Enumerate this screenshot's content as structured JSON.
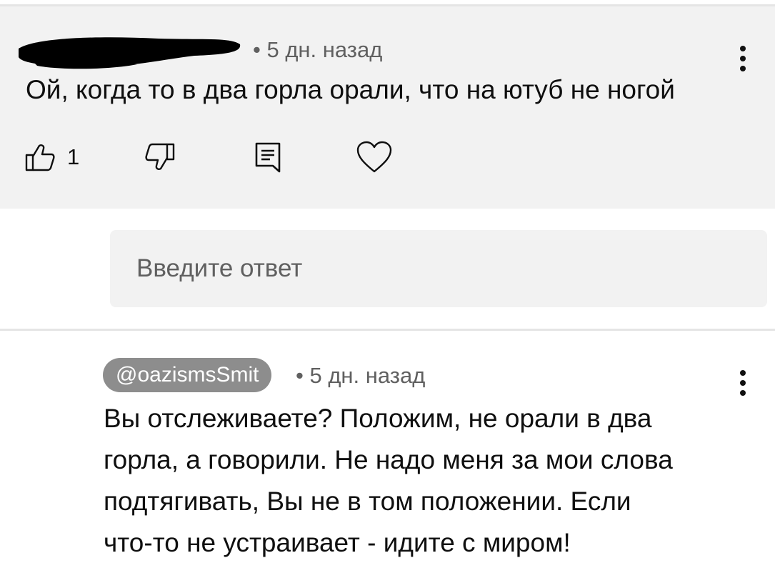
{
  "comment": {
    "time": "• 5 дн. назад",
    "text": "Ой, когда то в два горла орали, что на ютуб не ногой",
    "like_count": "1",
    "icons": {
      "like": "thumbs-up-icon",
      "dislike": "thumbs-down-icon",
      "reply": "reply-comment-icon",
      "heart": "heart-icon",
      "more": "more-vert-icon"
    }
  },
  "reply_input": {
    "placeholder": "Введите ответ"
  },
  "reply": {
    "author": "@oazismsSmit",
    "time": "• 5 дн. назад",
    "lines": [
      "Вы отслеживаете? Положим, не орали в два",
      "горла, а говорили. Не надо меня за мои слова",
      "подтягивать, Вы не в том положении. Если",
      "что-то не устраивает - идите с миром!"
    ]
  },
  "colors": {
    "panel": "#f2f2f2",
    "secondary_text": "#606060",
    "author_chip": "#8d8d8d"
  }
}
